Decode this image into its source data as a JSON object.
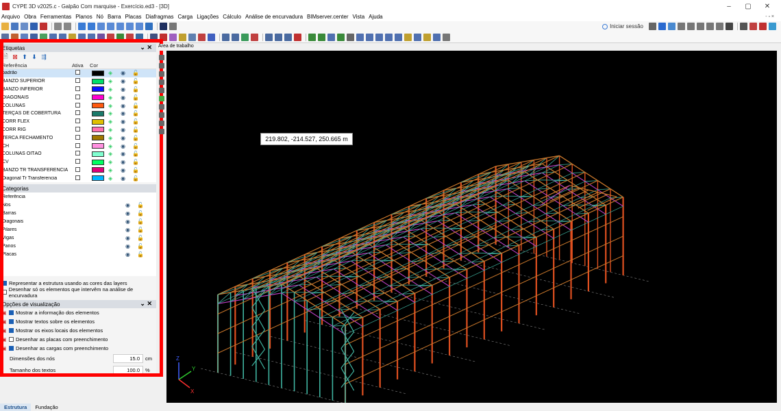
{
  "window": {
    "title": "CYPE 3D v2025.c - Galpão Com marquise - Exercício.ed3 - [3D]",
    "minimize": "–",
    "maximize": "▢",
    "close": "✕"
  },
  "menu": [
    "Arquivo",
    "Obra",
    "Ferramentas",
    "Planos",
    "Nó",
    "Barra",
    "Placas",
    "Diafragmas",
    "Carga",
    "Ligações",
    "Cálculo",
    "Análise de encurvadura",
    "BIMserver.center",
    "Vista",
    "Ajuda"
  ],
  "mdi_controls": "- ▫ ×",
  "account": {
    "login": "Iniciar sessão"
  },
  "viewport_tab": "Área de trabalho",
  "coordinate_readout": "219.802, -214.527, 250.665 m",
  "layers_panel": {
    "title": "Etiquetas",
    "close": "✕",
    "collapse": "⌄",
    "columns": {
      "ref": "Referência",
      "active": "Ativa",
      "color": "Cor"
    },
    "rows": [
      {
        "name": "padrão",
        "color": "#000000",
        "selected": true
      },
      {
        "name": "BANZO SUPERIOR",
        "color": "#00e06a"
      },
      {
        "name": "BANZO INFERIOR",
        "color": "#0a10ff"
      },
      {
        "name": "DIAGONAIS",
        "color": "#ff00d0"
      },
      {
        "name": "COLUNAS",
        "color": "#ff5a10"
      },
      {
        "name": "TERÇAS DE COBERTURA",
        "color": "#1a7a6a"
      },
      {
        "name": "CORR FLEX",
        "color": "#e0c000"
      },
      {
        "name": "CORR RÍG",
        "color": "#ff70b0"
      },
      {
        "name": "TERCA FECHAMENTO",
        "color": "#a07800"
      },
      {
        "name": "CH",
        "color": "#ff90e0"
      },
      {
        "name": "COLUNAS OITÃO",
        "color": "#80ffd0"
      },
      {
        "name": "CV",
        "color": "#00ff60"
      },
      {
        "name": "BANZO TR TRANSFERENCIA",
        "color": "#e0007a"
      },
      {
        "name": "Diagonal Tr Transferencia",
        "color": "#00b4ff"
      }
    ]
  },
  "categories_panel": {
    "title": "Categorias",
    "ref_header": "Referência",
    "rows": [
      "Nós",
      "Barras",
      "Diagonais",
      "Pilares",
      "Vigas",
      "Panos",
      "Placas"
    ]
  },
  "layer_options": {
    "use_layer_colors": "Representar a estrutura usando as cores das layers",
    "only_buckling": "Desenhar só os elementos que intervêm na análise de encurvadura"
  },
  "view_options": {
    "title": "Opções de visualização",
    "items": [
      {
        "label": "Mostrar a informação dos elementos",
        "checked": true
      },
      {
        "label": "Mostrar textos sobre os elementos",
        "checked": true
      },
      {
        "label": "Mostrar os eixos locais dos elementos",
        "checked": true
      },
      {
        "label": "Desenhar as placas com preenchimento",
        "checked": false
      },
      {
        "label": "Desenhar as cargas com preenchimento",
        "checked": true
      }
    ],
    "node_size_label": "Dimensões dos nós",
    "node_size_value": "15.0",
    "node_size_unit": "cm",
    "text_size_label": "Tamanho dos textos",
    "text_size_value": "100.0",
    "text_size_unit": "%"
  },
  "bottom_tabs": [
    "Estrutura",
    "Fundação"
  ],
  "axes": {
    "x": "X",
    "y": "Y",
    "z": "Z"
  },
  "colors": {
    "highlight_frame": "#ff0000",
    "frame_orange": "#c8762a",
    "frame_teal": "#3fb3a0",
    "frame_magenta": "#c040c8",
    "column_red": "#e05020"
  }
}
